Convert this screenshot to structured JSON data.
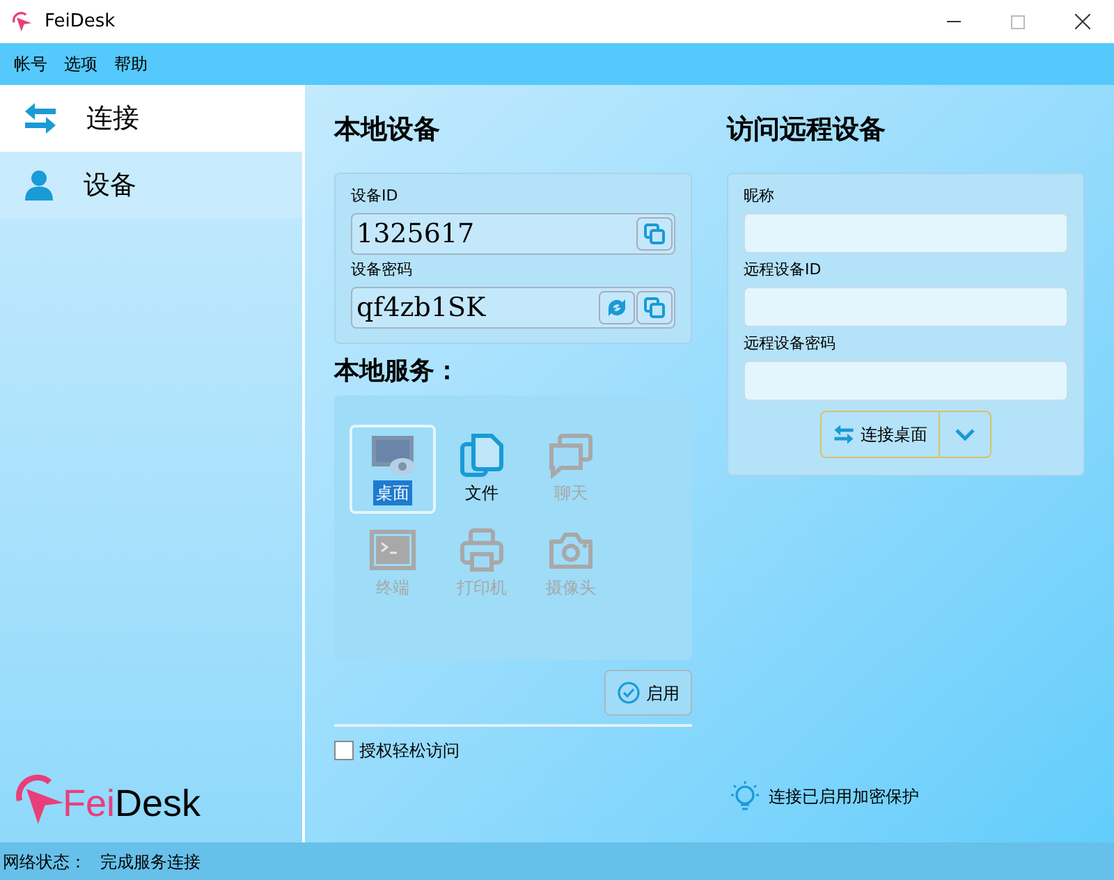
{
  "window": {
    "title": "FeiDesk"
  },
  "menu": [
    "帐号",
    "选项",
    "帮助"
  ],
  "sidebar": {
    "items": [
      {
        "label": "连接",
        "kind": "connect",
        "selected": true
      },
      {
        "label": "设备",
        "kind": "device",
        "selected": false
      }
    ],
    "logo": {
      "accent": "Fei",
      "rest": "Desk"
    }
  },
  "local": {
    "title": "本地设备",
    "id_label": "设备ID",
    "id_value": "1325617",
    "password_label": "设备密码",
    "password_value": "qf4zb1SK"
  },
  "services": {
    "title": "本地服务：",
    "items": [
      {
        "label": "桌面",
        "kind": "desktop",
        "enabled": true,
        "selected": true
      },
      {
        "label": "文件",
        "kind": "file",
        "enabled": true,
        "selected": false
      },
      {
        "label": "聊天",
        "kind": "chat",
        "enabled": false,
        "selected": false
      },
      {
        "label": "终端",
        "kind": "terminal",
        "enabled": false,
        "selected": false
      },
      {
        "label": "打印机",
        "kind": "printer",
        "enabled": false,
        "selected": false
      },
      {
        "label": "摄像头",
        "kind": "camera",
        "enabled": false,
        "selected": false
      }
    ],
    "enable_button": "启用",
    "easy_access": {
      "label": "授权轻松访问",
      "checked": false
    }
  },
  "remote": {
    "title": "访问远程设备",
    "fields": [
      {
        "label": "昵称"
      },
      {
        "label": "远程设备ID"
      },
      {
        "label": "远程设备密码"
      }
    ],
    "connect_button": "连接桌面",
    "notice": "连接已启用加密保护"
  },
  "status_bar": {
    "label": "网络状态：",
    "value": "完成服务连接"
  }
}
